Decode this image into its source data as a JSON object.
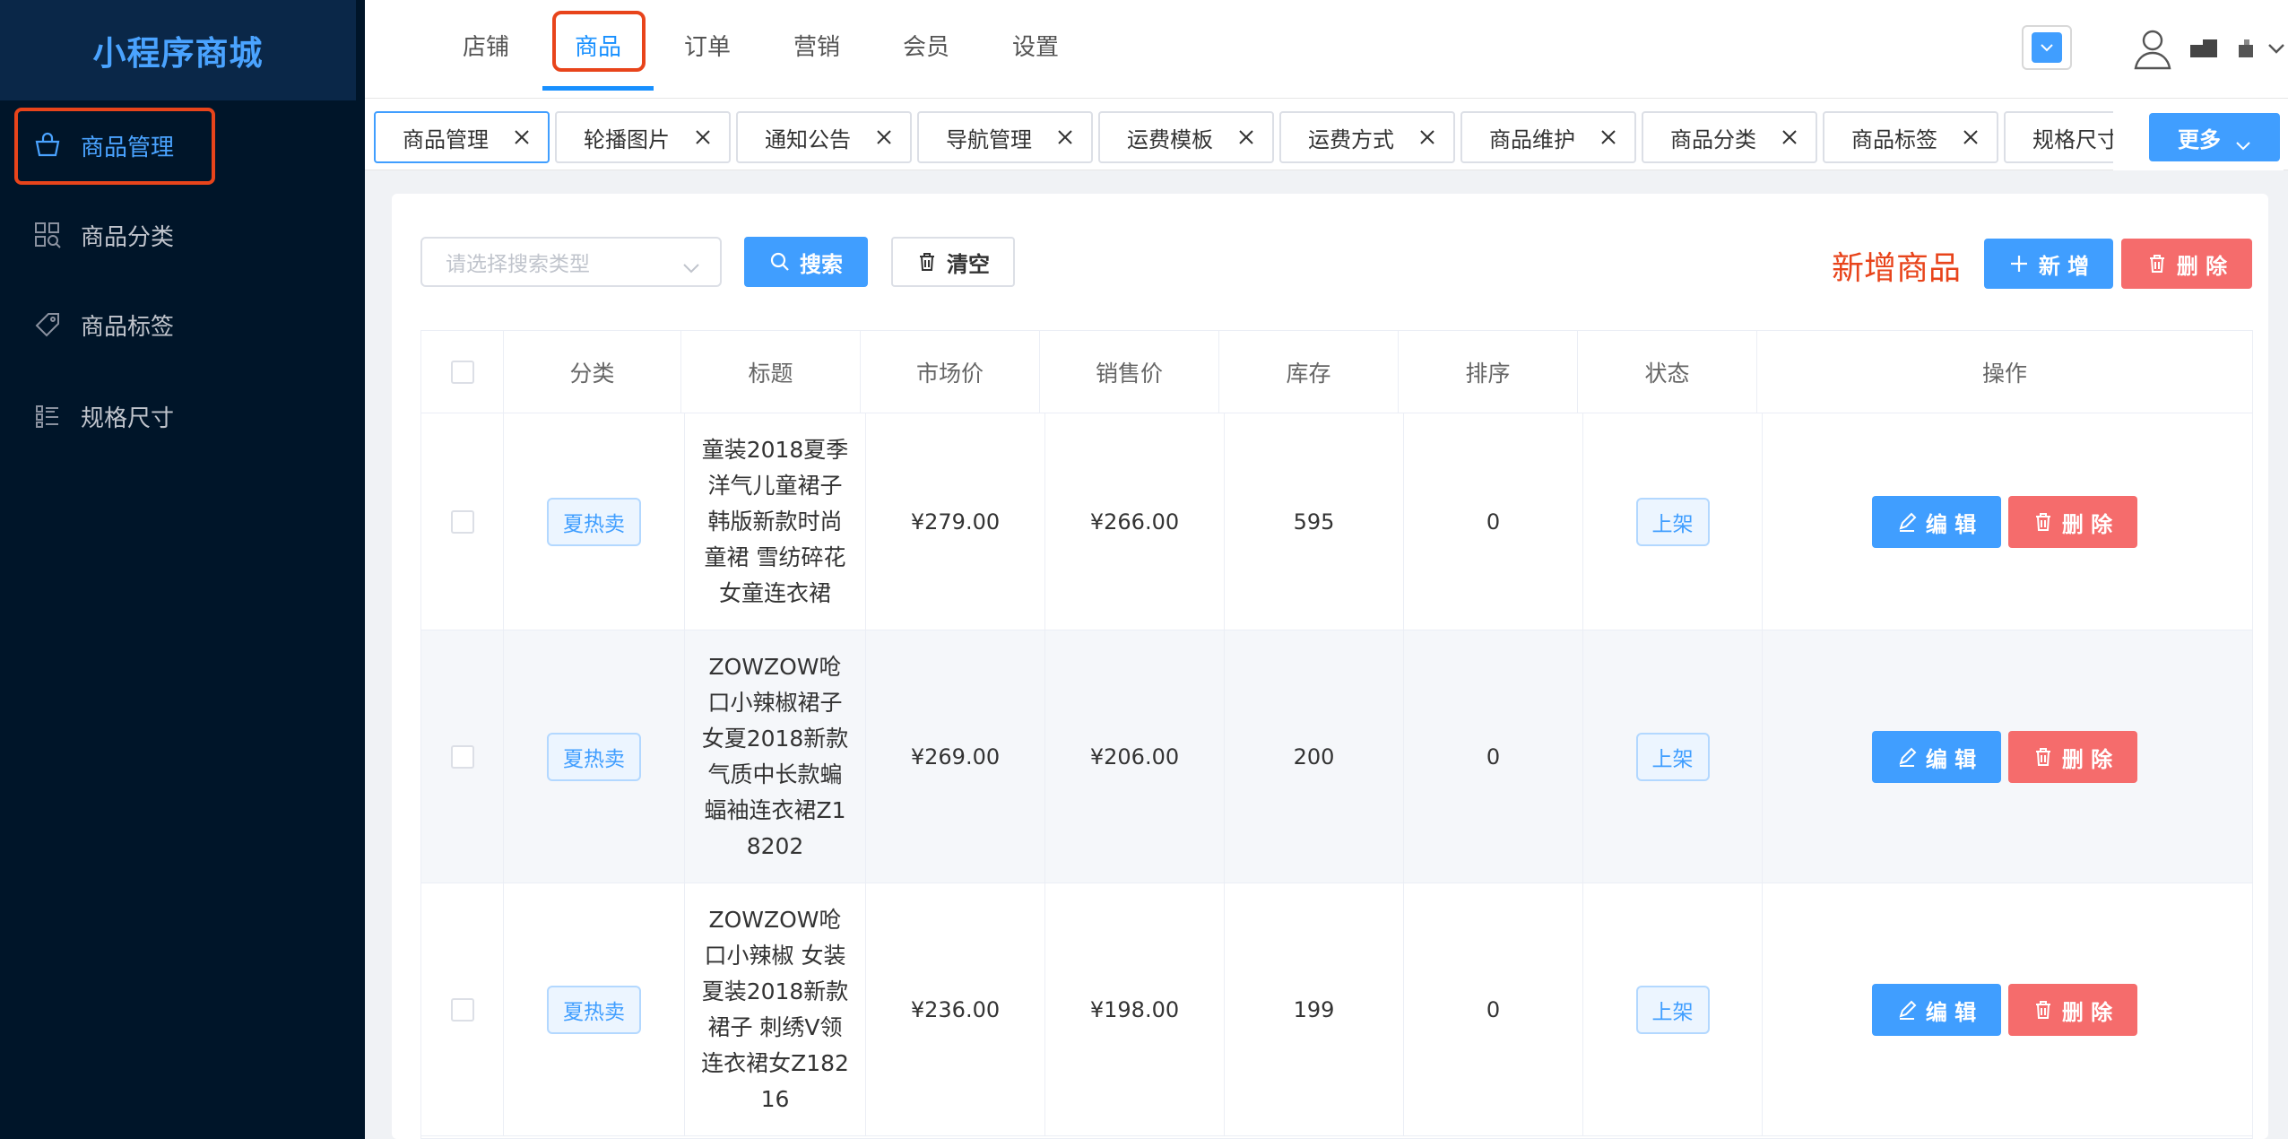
{
  "sidebar": {
    "brand": "小程序商城",
    "items": [
      {
        "label": "商品管理",
        "icon": "basket-icon",
        "active": true
      },
      {
        "label": "商品分类",
        "icon": "grid-search-icon",
        "active": false
      },
      {
        "label": "商品标签",
        "icon": "tag-icon",
        "active": false
      },
      {
        "label": "规格尺寸",
        "icon": "list-icon",
        "active": false
      }
    ]
  },
  "topnav": {
    "items": [
      "店铺",
      "商品",
      "订单",
      "营销",
      "会员",
      "设置"
    ],
    "active": "商品"
  },
  "tabs": {
    "items": [
      "商品管理",
      "轮播图片",
      "通知公告",
      "导航管理",
      "运费模板",
      "运费方式",
      "商品维护",
      "商品分类",
      "商品标签",
      "规格尺寸"
    ],
    "more_label": "更多"
  },
  "toolbar": {
    "search_placeholder": "请选择搜索类型",
    "search_label": "搜索",
    "clear_label": "清空",
    "page_title": "新增商品",
    "add_label": "新 增",
    "delete_label": "删 除"
  },
  "table": {
    "headers": [
      "分类",
      "标题",
      "市场价",
      "销售价",
      "库存",
      "排序",
      "状态",
      "操作"
    ],
    "edit_label": "编 辑",
    "delete_label": "删 除",
    "rows": [
      {
        "category": "夏热卖",
        "title": "童装2018夏季洋气儿童裙子韩版新款时尚童裙 雪纺碎花女童连衣裙",
        "market_price": "¥279.00",
        "sale_price": "¥266.00",
        "stock": "595",
        "sort": "0",
        "status": "上架"
      },
      {
        "category": "夏热卖",
        "title": "ZOWZOW呛口小辣椒裙子女夏2018新款气质中长款蝙蝠袖连衣裙Z18202",
        "market_price": "¥269.00",
        "sale_price": "¥206.00",
        "stock": "200",
        "sort": "0",
        "status": "上架"
      },
      {
        "category": "夏热卖",
        "title": "ZOWZOW呛口小辣椒 女装夏装2018新款裙子 刺绣V领连衣裙女Z18216",
        "market_price": "¥236.00",
        "sale_price": "¥198.00",
        "stock": "199",
        "sort": "0",
        "status": "上架"
      }
    ]
  },
  "colors": {
    "primary": "#409eff",
    "danger": "#f56c6c",
    "highlight": "#e8441b",
    "sidebar_bg": "#001529"
  }
}
